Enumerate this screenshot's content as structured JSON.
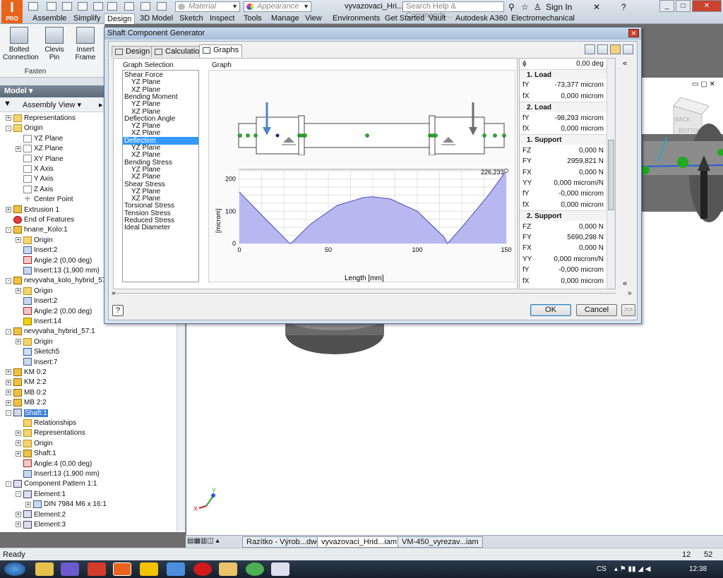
{
  "app": {
    "logo_main": "I",
    "logo_sub": "PRO",
    "material": "Material",
    "appearance": "Appearance",
    "doc_title": "vyvazovaci_Hri...",
    "search_placeholder": "Search Help & Commands...",
    "sign_in": "Sign In"
  },
  "menu": [
    "Assemble",
    "Simplify",
    "Design",
    "3D Model",
    "Sketch",
    "Inspect",
    "Tools",
    "Manage",
    "View",
    "Environments",
    "Get Started",
    "Vault",
    "Autodesk A360",
    "Electromechanical"
  ],
  "ribbon": {
    "buttons": [
      {
        "label": "Bolted\nConnection"
      },
      {
        "label": "Clevis\nPin"
      },
      {
        "label": "Insert\nFrame"
      }
    ],
    "panel_label": "Fasten"
  },
  "browser": {
    "title": "Model",
    "view_label": "Assembly View",
    "tree": [
      {
        "label": "Representations",
        "icon": "folder",
        "exp": "+",
        "indent": 0
      },
      {
        "label": "Origin",
        "icon": "folder",
        "exp": "-",
        "indent": 0
      },
      {
        "label": "YZ Plane",
        "icon": "plane",
        "indent": 1
      },
      {
        "label": "XZ Plane",
        "icon": "plane",
        "exp": "+",
        "indent": 1
      },
      {
        "label": "XY Plane",
        "icon": "plane",
        "indent": 1
      },
      {
        "label": "X Axis",
        "icon": "plane",
        "indent": 1
      },
      {
        "label": "Y Axis",
        "icon": "plane",
        "indent": 1
      },
      {
        "label": "Z Axis",
        "icon": "plane",
        "indent": 1
      },
      {
        "label": "Center Point",
        "icon": "point",
        "indent": 1
      },
      {
        "label": "Extrusion 1",
        "icon": "part",
        "exp": "+",
        "indent": 0
      },
      {
        "label": "End of Features",
        "icon": "stop",
        "indent": 0
      },
      {
        "label": "hnane_Kolo:1",
        "icon": "part",
        "exp": "-",
        "indent": 0
      },
      {
        "label": "Origin",
        "icon": "folder",
        "exp": "+",
        "indent": 1
      },
      {
        "label": "Insert:2",
        "icon": "insert",
        "indent": 1
      },
      {
        "label": "Angle:2 (0,00 deg)",
        "icon": "angle",
        "indent": 1
      },
      {
        "label": "Insert:13 (1,900 mm)",
        "icon": "insert",
        "indent": 1
      },
      {
        "label": "nevyvaha_kolo_hybrid_57:1",
        "icon": "part",
        "exp": "-",
        "indent": 0
      },
      {
        "label": "Origin",
        "icon": "folder",
        "exp": "+",
        "indent": 1
      },
      {
        "label": "Insert:2",
        "icon": "insert",
        "indent": 1
      },
      {
        "label": "Angle:2 (0,00 deg)",
        "icon": "angle",
        "indent": 1
      },
      {
        "label": "Insert:14",
        "icon": "warn",
        "indent": 1
      },
      {
        "label": "nevyvaha_hybrid_57:1",
        "icon": "part",
        "exp": "-",
        "indent": 0
      },
      {
        "label": "Origin",
        "icon": "folder",
        "exp": "+",
        "indent": 1
      },
      {
        "label": "Sketch5",
        "icon": "sketch",
        "indent": 1
      },
      {
        "label": "Insert:7",
        "icon": "insert",
        "indent": 1
      },
      {
        "label": "KM 0:2",
        "icon": "part",
        "exp": "+",
        "indent": 0
      },
      {
        "label": "KM 2:2",
        "icon": "part",
        "exp": "+",
        "indent": 0
      },
      {
        "label": "MB 0:2",
        "icon": "part",
        "exp": "+",
        "indent": 0
      },
      {
        "label": "MB 2:2",
        "icon": "part",
        "exp": "+",
        "indent": 0
      },
      {
        "label": "Shaft:1",
        "icon": "shaft",
        "exp": "-",
        "indent": 0,
        "selected": true
      },
      {
        "label": "Relationships",
        "icon": "folder",
        "indent": 1
      },
      {
        "label": "Representations",
        "icon": "folder",
        "exp": "+",
        "indent": 1
      },
      {
        "label": "Origin",
        "icon": "folder",
        "exp": "+",
        "indent": 1
      },
      {
        "label": "Shaft:1",
        "icon": "part",
        "exp": "+",
        "indent": 1
      },
      {
        "label": "Angle:4 (0,00 deg)",
        "icon": "angle",
        "indent": 1
      },
      {
        "label": "Insert:13 (1,900 mm)",
        "icon": "insert",
        "indent": 1
      },
      {
        "label": "Component Pattern 1:1",
        "icon": "pattern",
        "exp": "-",
        "indent": 0
      },
      {
        "label": "Element:1",
        "icon": "pattern",
        "exp": "-",
        "indent": 1
      },
      {
        "label": "DIN 7984 M6 x 16:1",
        "icon": "insert",
        "exp": "+",
        "indent": 2
      },
      {
        "label": "Element:2",
        "icon": "pattern",
        "exp": "+",
        "indent": 1
      },
      {
        "label": "Element:3",
        "icon": "pattern",
        "exp": "+",
        "indent": 1
      }
    ]
  },
  "dialog": {
    "title": "Shaft Component Generator",
    "tabs": [
      "Design",
      "Calculation",
      "Graphs"
    ],
    "graph_selection_label": "Graph Selection",
    "graph_label": "Graph",
    "graph_selection": [
      {
        "label": "Shear Force",
        "indent": 0
      },
      {
        "label": "YZ Plane",
        "indent": 1
      },
      {
        "label": "XZ Plane",
        "indent": 1
      },
      {
        "label": "Bending Moment",
        "indent": 0
      },
      {
        "label": "YZ Plane",
        "indent": 1
      },
      {
        "label": "XZ Plane",
        "indent": 1
      },
      {
        "label": "Deflection Angle",
        "indent": 0
      },
      {
        "label": "YZ Plane",
        "indent": 1
      },
      {
        "label": "XZ Plane",
        "indent": 1
      },
      {
        "label": "Deflection",
        "indent": 0,
        "selected": true
      },
      {
        "label": "YZ Plane",
        "indent": 1
      },
      {
        "label": "XZ Plane",
        "indent": 1
      },
      {
        "label": "Bending Stress",
        "indent": 0
      },
      {
        "label": "YZ Plane",
        "indent": 1
      },
      {
        "label": "XZ Plane",
        "indent": 1
      },
      {
        "label": "Shear Stress",
        "indent": 0
      },
      {
        "label": "YZ Plane",
        "indent": 1
      },
      {
        "label": "XZ Plane",
        "indent": 1
      },
      {
        "label": "Torsional Stress",
        "indent": 0
      },
      {
        "label": "Tension Stress",
        "indent": 0
      },
      {
        "label": "Reduced Stress",
        "indent": 0
      },
      {
        "label": "Ideal Diameter",
        "indent": 0
      }
    ],
    "results": {
      "angle_value": "0,00 deg",
      "sections": [
        {
          "title": "1. Load",
          "rows": [
            {
              "sym": "fY",
              "val": "-73,377 microm"
            },
            {
              "sym": "fX",
              "val": "0,000 microm"
            }
          ]
        },
        {
          "title": "2. Load",
          "rows": [
            {
              "sym": "fY",
              "val": "-98,293 microm"
            },
            {
              "sym": "fX",
              "val": "0,000 microm"
            }
          ]
        },
        {
          "title": "1. Support",
          "rows": [
            {
              "sym": "FZ",
              "val": "0,000 N"
            },
            {
              "sym": "FY",
              "val": "2959,821 N"
            },
            {
              "sym": "FX",
              "val": "0,000 N"
            },
            {
              "sym": "YY",
              "val": "0,000 microm/N"
            },
            {
              "sym": "fY",
              "val": "-0,000 microm"
            },
            {
              "sym": "fX",
              "val": "0,000 microm"
            }
          ]
        },
        {
          "title": "2. Support",
          "rows": [
            {
              "sym": "FZ",
              "val": "0,000 N"
            },
            {
              "sym": "FY",
              "val": "5690,298 N"
            },
            {
              "sym": "FX",
              "val": "0,000 N"
            },
            {
              "sym": "YY",
              "val": "0,000 microm/N"
            },
            {
              "sym": "fY",
              "val": "-0,000 microm"
            },
            {
              "sym": "fX",
              "val": "0,000 microm"
            }
          ]
        }
      ]
    },
    "buttons": {
      "ok": "OK",
      "cancel": "Cancel",
      "more": ">>"
    }
  },
  "chart_data": {
    "type": "area",
    "xlabel": "Length [mm]",
    "ylabel": "[microm]",
    "xlim": [
      0,
      150
    ],
    "ylim": [
      0,
      230
    ],
    "xticks": [
      0,
      50,
      100,
      150
    ],
    "yticks": [
      0,
      100,
      200
    ],
    "annotation": "226,233",
    "grid": true,
    "fill_color": "#b8b8f0",
    "line_color": "#4a4ab8",
    "x": [
      0,
      14,
      28,
      29,
      40,
      55,
      70,
      75,
      85,
      100,
      115,
      117,
      125,
      140,
      150
    ],
    "y": [
      160,
      80,
      2,
      0,
      60,
      118,
      143,
      145,
      138,
      100,
      20,
      0,
      50,
      150,
      226
    ]
  },
  "doc_tabs": [
    "Razítko - Výrob...dwg",
    "vyvazovaci_Hrid...iam",
    "VM-450_vyrezav...iam"
  ],
  "status": {
    "text": "Ready",
    "count1": "12",
    "count2": "52"
  },
  "taskbar": {
    "lang": "CS",
    "time": "12:38"
  }
}
